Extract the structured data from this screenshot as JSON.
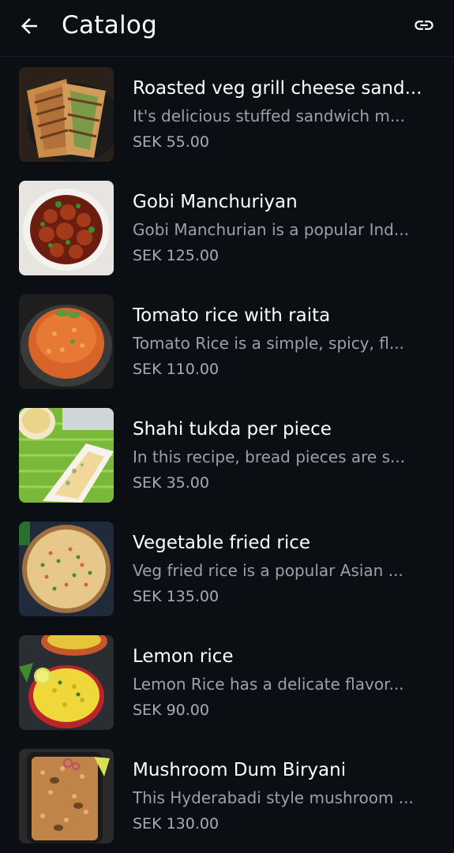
{
  "header": {
    "title": "Catalog",
    "back_icon": "arrow-left-icon",
    "action_icon": "link-icon"
  },
  "items": [
    {
      "name": "Roasted veg grill cheese sand...",
      "description": "It's delicious stuffed sandwich m...",
      "price": "SEK 55.00"
    },
    {
      "name": "Gobi Manchuriyan",
      "description": "Gobi Manchurian is a popular Ind...",
      "price": "SEK 125.00"
    },
    {
      "name": "Tomato rice with raita",
      "description": "Tomato Rice is a simple, spicy, fl...",
      "price": "SEK 110.00"
    },
    {
      "name": "Shahi tukda per piece",
      "description": "In this recipe, bread pieces are s...",
      "price": "SEK 35.00"
    },
    {
      "name": "Vegetable fried rice",
      "description": "Veg fried rice is a popular Asian ...",
      "price": "SEK 135.00"
    },
    {
      "name": "Lemon rice",
      "description": "Lemon Rice has a delicate flavor...",
      "price": "SEK 90.00"
    },
    {
      "name": "Mushroom Dum Biryani",
      "description": "This Hyderabadi style mushroom ...",
      "price": "SEK 130.00"
    }
  ]
}
